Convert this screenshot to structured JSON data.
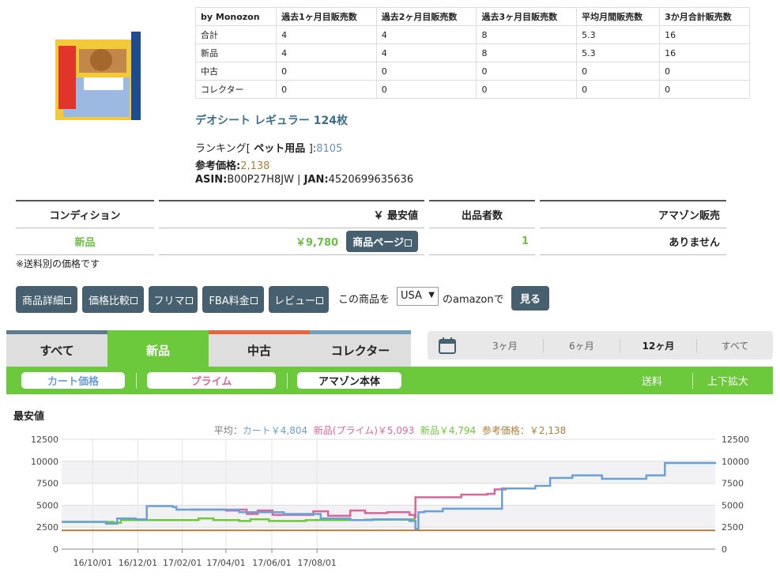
{
  "sales_table": {
    "headers": [
      "by Monozon",
      "過去1ヶ月目販売数",
      "過去2ヶ月目販売数",
      "過去3ヶ月目販売数",
      "平均月間販売数",
      "3か月合計販売数"
    ],
    "rows": [
      [
        "合計",
        "4",
        "4",
        "8",
        "5.3",
        "16"
      ],
      [
        "新品",
        "4",
        "4",
        "8",
        "5.3",
        "16"
      ],
      [
        "中古",
        "0",
        "0",
        "0",
        "0",
        "0"
      ],
      [
        "コレクター",
        "0",
        "0",
        "0",
        "0",
        "0"
      ]
    ]
  },
  "product": {
    "title": "デオシート レギュラー 124枚",
    "ranking_label": "ランキング[",
    "ranking_category": " ペット用品 ",
    "ranking_sep": "]:",
    "ranking_value": "8105",
    "price_label": "参考価格:",
    "price_value": "2,138",
    "asin_label": "ASIN:",
    "asin_value": "B00P27H8JW",
    "jan_sep": " | ",
    "jan_label": "JAN:",
    "jan_value": "4520699635636"
  },
  "condition_table": {
    "headers": [
      "コンディション",
      "￥ 最安値",
      "出品者数",
      "アマゾン販売"
    ],
    "row": {
      "condition": "新品",
      "price": "￥9,780",
      "page_button": "商品ページ",
      "sellers": "1",
      "amazon": "ありません"
    }
  },
  "note": "※送料別の価格です",
  "buttons": [
    "商品詳細",
    "価格比較",
    "フリマ",
    "FBA料金",
    "レビュー"
  ],
  "country": {
    "prefix": "この商品を",
    "selected": "USA",
    "suffix": "のamazonで",
    "go": "見る"
  },
  "tabs": [
    "すべて",
    "新品",
    "中古",
    "コレクター"
  ],
  "active_tab": "新品",
  "periods": [
    "3ヶ月",
    "6ヶ月",
    "12ヶ月",
    "すべて"
  ],
  "active_period": "12ヶ月",
  "filters": {
    "cart": "カート価格",
    "prime": "プライム",
    "amazon": "アマゾン本体",
    "shipping": "送料",
    "zoom": "上下拡大"
  },
  "chart_title": "最安値",
  "legend": {
    "prefix": "平均：",
    "cart": "カート￥4,804",
    "prime": "新品(プライム)￥5,093",
    "newp": "新品￥4,794",
    "ref": "参考価格：￥2,138"
  },
  "colors": {
    "cart": "#6a9fd8",
    "prime": "#d9669a",
    "new": "#6cc93c",
    "ref": "#b07d3a",
    "accent": "#46606f"
  },
  "chart_data": {
    "type": "line",
    "title": "最安値",
    "x_ticks": [
      "16/10/01",
      "16/12/01",
      "17/02/01",
      "17/04/01",
      "17/06/01",
      "17/08/01"
    ],
    "x_range": [
      "2016-08-20",
      "2017-09-05"
    ],
    "ylim": [
      0,
      12500
    ],
    "y_ticks": [
      0,
      2500,
      5000,
      7500,
      10000,
      12500
    ],
    "series": [
      {
        "color": "#6cc93c",
        "values": [
          [
            0,
            3100
          ],
          [
            40,
            3100
          ],
          [
            70,
            3000
          ],
          [
            80,
            3300
          ],
          [
            110,
            3300
          ],
          [
            180,
            3300
          ],
          [
            185,
            3500
          ],
          [
            200,
            3500
          ],
          [
            205,
            3300
          ],
          [
            240,
            3200
          ],
          [
            255,
            3400
          ],
          [
            280,
            3200
          ],
          [
            300,
            3200
          ],
          [
            330,
            3300
          ],
          [
            350,
            3300
          ],
          [
            395,
            3300
          ],
          [
            410,
            3350
          ],
          [
            470,
            3400
          ],
          [
            478,
            3400
          ]
        ]
      },
      {
        "color": "#d9669a",
        "values": [
          [
            175,
            4500
          ],
          [
            222,
            4400
          ],
          [
            232,
            4400
          ],
          [
            240,
            4500
          ],
          [
            250,
            4000
          ],
          [
            265,
            4400
          ],
          [
            283,
            4400
          ],
          [
            285,
            3900
          ],
          [
            315,
            3900
          ],
          [
            340,
            4300
          ],
          [
            355,
            4300
          ],
          [
            360,
            3800
          ],
          [
            380,
            3800
          ],
          [
            390,
            4400
          ],
          [
            410,
            4100
          ],
          [
            440,
            4200
          ],
          [
            470,
            3900
          ],
          [
            477,
            3600
          ],
          [
            478,
            5900
          ],
          [
            540,
            6200
          ],
          [
            565,
            6200
          ],
          [
            575,
            6300
          ],
          [
            585,
            6800
          ],
          [
            600,
            6900
          ]
        ]
      },
      {
        "color": "#6a9fd8",
        "values": [
          [
            0,
            3100
          ],
          [
            30,
            3100
          ],
          [
            60,
            2900
          ],
          [
            75,
            3500
          ],
          [
            100,
            3400
          ],
          [
            115,
            4900
          ],
          [
            150,
            4800
          ],
          [
            155,
            4500
          ],
          [
            220,
            4500
          ],
          [
            240,
            4200
          ],
          [
            300,
            4000
          ],
          [
            350,
            3500
          ],
          [
            390,
            3300
          ],
          [
            420,
            3400
          ],
          [
            455,
            3400
          ],
          [
            470,
            3200
          ],
          [
            478,
            3200
          ],
          [
            478,
            2300
          ],
          [
            482,
            4200
          ],
          [
            490,
            4300
          ],
          [
            515,
            4600
          ],
          [
            595,
            6900
          ],
          [
            605,
            6900
          ],
          [
            640,
            7200
          ],
          [
            660,
            8100
          ],
          [
            690,
            8400
          ],
          [
            720,
            8400
          ],
          [
            730,
            8000
          ],
          [
            760,
            8000
          ],
          [
            790,
            8400
          ],
          [
            800,
            8400
          ],
          [
            815,
            9800
          ],
          [
            880,
            9800
          ],
          [
            883,
            9900
          ]
        ]
      },
      {
        "color": "#b07d3a",
        "values": [
          [
            0,
            2138
          ],
          [
            883,
            2138
          ]
        ]
      }
    ]
  }
}
